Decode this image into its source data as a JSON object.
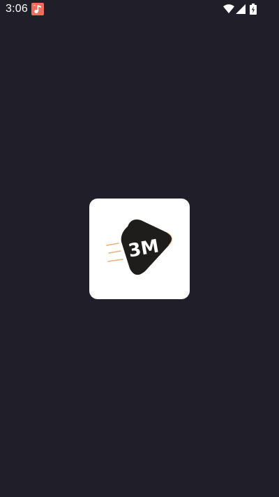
{
  "status_bar": {
    "time": "3:06",
    "notification_icon": "music-note-icon",
    "wifi_icon": "wifi-icon",
    "signal_icon": "cellular-signal-icon",
    "battery_icon": "battery-charging-icon"
  },
  "splash": {
    "logo_text": "3M",
    "logo_icon": "app-logo-icon"
  },
  "colors": {
    "background": "#201f29",
    "logo_tile": "#ffffff",
    "logo_badge": "#1f1d1b",
    "speed_lines": "#e7b17a",
    "notification_badge": "#f06b5b"
  }
}
